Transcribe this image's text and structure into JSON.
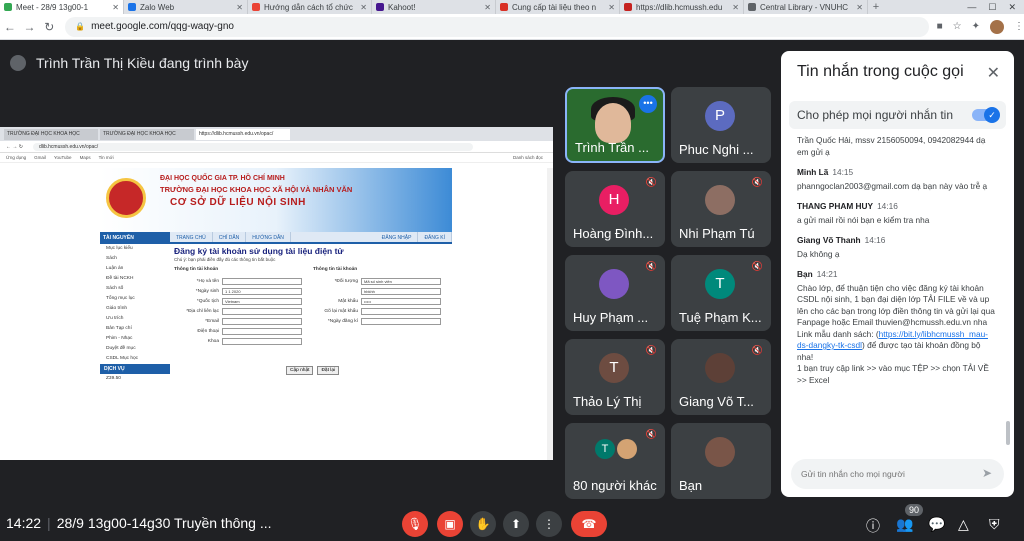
{
  "browser": {
    "tabs": [
      {
        "title": "Meet - 28/9 13g00-1",
        "color": "#34a853",
        "active": true
      },
      {
        "title": "Zalo Web",
        "color": "#1a73e8",
        "active": false
      },
      {
        "title": "Hướng dẫn cách tổ chức",
        "color": "#ea4335",
        "active": false
      },
      {
        "title": "Kahoot!",
        "color": "#46178f",
        "active": false
      },
      {
        "title": "Cung cấp tài liệu theo n",
        "color": "#d93025",
        "active": false
      },
      {
        "title": "https://dlib.hcmussh.edu",
        "color": "#c5221f",
        "active": false
      },
      {
        "title": "Central Library - VNUHC",
        "color": "#5f6368",
        "active": false
      }
    ],
    "new_tab": "+",
    "url": "meet.google.com/qqg-waqy-gno"
  },
  "presenting": {
    "text": "Trình Trần Thị Kiều đang trình bày"
  },
  "shared_screen": {
    "tabs": [
      "TRƯỜNG ĐẠI HỌC KHOA HỌC",
      "TRƯỜNG ĐẠI HỌC KHOA HỌC",
      "https://dlib.hcmussh.edu.vn/opac/"
    ],
    "url": "dlib.hcmussh.edu.vn/opac/",
    "bookmarks": [
      "Ứng dụng",
      "Gmail",
      "YouTube",
      "Maps",
      "Tin mới"
    ],
    "bookmark_right": "Danh sách đọc",
    "banner_line1": "ĐẠI HỌC QUỐC GIA TP. HỒ CHÍ MINH",
    "banner_line2": "TRƯỜNG ĐẠI HỌC KHOA HỌC XÃ HỘI VÀ NHÂN VĂN",
    "banner_line3": "CƠ SỞ DỮ LIỆU NỘI SINH",
    "nav": [
      "TRANG CHỦ",
      "CHỈ DẪN",
      "HƯỚNG DẪN"
    ],
    "nav_right": [
      "ĐĂNG NHẬP",
      "ĐĂNG KÍ"
    ],
    "side_head": "TÀI NGUYÊN",
    "side_items": [
      "Mục lục kiểu",
      "Sách",
      "Luận án",
      "Đề tài NCKH",
      "Sách số",
      "Tổng mục lục",
      "Giáo trình",
      "Ưu trích",
      "Bản Tạp chí",
      "Phim - Nhạc",
      "Duyệt đề mục",
      "CSDL Mục học"
    ],
    "side_head2": "DỊCH VỤ",
    "side_items2": [
      "Z39.50"
    ],
    "form_title": "Đăng ký tài khoản sử dụng tài liệu điện tử",
    "form_note": "Chú ý: bạn phải điền đầy đủ các thông tin bắt buộc",
    "col1_title": "Thông tin tài khoản",
    "col1_fields": [
      {
        "label": "*Họ và tên",
        "value": ""
      },
      {
        "label": "*Ngày sinh",
        "value": "1   1   2020"
      },
      {
        "label": "*Quốc tịch",
        "value": "Vietnam"
      },
      {
        "label": "*Địa chỉ liên lạc",
        "value": ""
      },
      {
        "label": "*Email",
        "value": ""
      },
      {
        "label": "Điện thoại",
        "value": ""
      },
      {
        "label": "Khoa",
        "value": ""
      }
    ],
    "col2_title": "Thông tin tài khoản",
    "col2_fields": [
      {
        "label": "*Đối tượng",
        "value": "Mã số sinh viên"
      },
      {
        "label": "",
        "value": "hbkhh"
      },
      {
        "label": "Mật khẩu",
        "value": "•••••"
      },
      {
        "label": "Gõ lại mật khẩu",
        "value": ""
      },
      {
        "label": "*Ngày đăng kí",
        "value": ""
      }
    ],
    "btn_update": "Cập nhật",
    "btn_reset": "Đặt lại"
  },
  "participants": [
    {
      "name": "Trình Trần ...",
      "initial": "",
      "color": "",
      "presenter": true
    },
    {
      "name": "Phuc Nghi ...",
      "initial": "P",
      "color": "#5c6bc0"
    },
    {
      "name": "Hoàng Đình...",
      "initial": "H",
      "color": "#e91e63"
    },
    {
      "name": "Nhi Phạm Tú",
      "initial": "",
      "color": "#8d6e63"
    },
    {
      "name": "Huy Phạm ...",
      "initial": "",
      "color": "#7e57c2"
    },
    {
      "name": "Tuệ Phạm K...",
      "initial": "T",
      "color": "#00897b"
    },
    {
      "name": "Thảo Lý Thị",
      "initial": "T",
      "color": "#6d4c41"
    },
    {
      "name": "Giang Võ T...",
      "initial": "",
      "color": "#5d4037"
    },
    {
      "name": "80 người khác",
      "initial": "T",
      "color": "#00796b"
    },
    {
      "name": "Bạn",
      "initial": "",
      "color": "#795548"
    }
  ],
  "chat": {
    "title": "Tin nhắn trong cuộc gọi",
    "allow_label": "Cho phép mọi người nhắn tin",
    "messages": [
      {
        "sender": "",
        "time": "",
        "text": "Trần Quốc Hải, mssv 2156050094, 0942082944 dạ em gửi ạ",
        "link": ""
      },
      {
        "sender": "Minh Lã",
        "time": "14:15",
        "text": "phanngoclan2003@gmail.com dạ bạn này vào trễ ạ",
        "link": ""
      },
      {
        "sender": "THANG PHAM HUY",
        "time": "14:16",
        "text": "a gửi mail rồi nói bạn e kiểm tra nha",
        "link": ""
      },
      {
        "sender": "Giang Võ Thanh",
        "time": "14:16",
        "text": "Dạ không ạ",
        "link": ""
      },
      {
        "sender": "Bạn",
        "time": "14:21",
        "text": "Chào lớp, để thuận tiện cho việc đăng ký tài khoản CSDL nội sinh, 1 bạn đại diện lớp TẢI FILE về và up lên cho các bạn trong lớp điền thông tin và gửi lại qua Fanpage hoặc Email thuvien@hcmussh.edu.vn nha Link mẫu danh sách:",
        "link": "https://bit.ly/libhcmussh_mau-ds-dangky-tk-csdl",
        "after": "để được tạo tài khoản đồng bộ nha!",
        "extra": "1 bạn truy cập link >> vào mục TỆP >> chọn TẢI VỀ >> Excel"
      }
    ],
    "input_placeholder": "Gửi tin nhắn cho mọi người"
  },
  "bottom": {
    "time": "14:22",
    "meeting_name": "28/9 13g00-14g30 Truyền thông ...",
    "participant_count": "90"
  }
}
